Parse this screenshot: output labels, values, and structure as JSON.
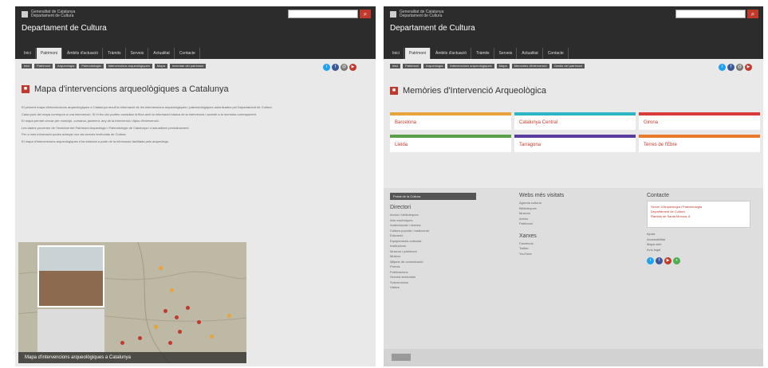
{
  "left": {
    "logo_text": "Generalitat de Catalunya Departament de Cultura",
    "dept": "Departament de Cultura",
    "search_placeholder": "",
    "nav": [
      "Inici",
      "Patrimoni",
      "Àmbits d'actuació",
      "Tràmits",
      "Serveis",
      "Actualitat",
      "Contacte"
    ],
    "nav_active": 1,
    "crumbs": [
      "Inici",
      "Patrimoni",
      "Arqueologia",
      "Paleontologia",
      "Intervencions arqueològiques",
      "Mapa",
      "Inventari del patrimoni"
    ],
    "title": "Mapa d'intervencions arqueològiques a Catalunya",
    "paragraphs": [
      "El present mapa d'intervencions arqueològiques a Catalunya recull la informació de les intervencions arqueològiques i paleontològiques autoritzades pel Departament de Cultura.",
      "Cada punt del mapa correspon a una intervenció. Si hi feu clic podreu consultar la fitxa amb la informació bàsica de la intervenció i accedir a la memòria corresponent.",
      "El mapa permet cercar per municipi, comarca, jaciment, any de la intervenció i tipus d'intervenció.",
      "Les dades provenen de l'Inventari del Patrimoni Arqueològic i Paleontològic de Catalunya i s'actualitzen periòdicament.",
      "Per a més informació podeu adreçar-vos als serveis territorials de Cultura.",
      "El mapa d'intervencions arqueològiques s'ha elaborat a partir de la informació facilitada pels arqueòlegs."
    ],
    "map_caption": "Mapa d'intervencions arqueològiques a Catalunya"
  },
  "right": {
    "logo_text": "Generalitat de Catalunya Departament de Cultura",
    "dept": "Departament de Cultura",
    "nav": [
      "Inici",
      "Patrimoni",
      "Àmbits d'actuació",
      "Tràmits",
      "Serveis",
      "Actualitat",
      "Contacte"
    ],
    "nav_active": 1,
    "crumbs": [
      "Inici",
      "Patrimoni",
      "Arqueologia",
      "Intervencions arqueològiques",
      "Mapa",
      "Memòries d'intervenció",
      "Gestió del patrimoni"
    ],
    "title": "Memòries d'Intervenció Arqueològica",
    "regions": [
      {
        "name": "Barcelona",
        "color": "#e8a33a"
      },
      {
        "name": "Catalunya Central",
        "color": "#2bb6c6"
      },
      {
        "name": "Girona",
        "color": "#d93a3a"
      },
      {
        "name": "Lleida",
        "color": "#5aa048"
      },
      {
        "name": "Tarragona",
        "color": "#5a3b9e"
      },
      {
        "name": "Terres de l'Ebre",
        "color": "#e87a2a"
      }
    ],
    "footer": {
      "button": "Portal de la Cultura",
      "col1_title": "Directori",
      "col1_items": [
        "Arxius i biblioteques",
        "Arts escèniques",
        "Audiovisuals i cinema",
        "Cultura popular i tradicional",
        "Educació",
        "Equipaments culturals",
        "Institucions",
        "Museus i patrimoni",
        "Música",
        "Mitjans de comunicació",
        "Premis",
        "Publicacions",
        "Serveis territorials",
        "Subvencions",
        "Visites"
      ],
      "col2_title": "Webs més visitats",
      "col2_items": [
        "Agenda cultural",
        "Biblioteques",
        "Museus",
        "Arxius",
        "Patrimoni"
      ],
      "col2b_title": "Xarxes",
      "col2b_items": [
        "Facebook",
        "Twitter",
        "YouTube"
      ],
      "col3_title": "Contacte",
      "contact_lines": [
        "Servei d'Arqueologia i Paleontologia",
        "Departament de Cultura",
        "Rambla de Santa Mònica, 8"
      ],
      "col3_items": [
        "Ajuda",
        "Accessibilitat",
        "Mapa web",
        "Avís legal"
      ]
    }
  },
  "colors": {
    "accent": "#c0392b",
    "dark": "#2c2c2c"
  }
}
